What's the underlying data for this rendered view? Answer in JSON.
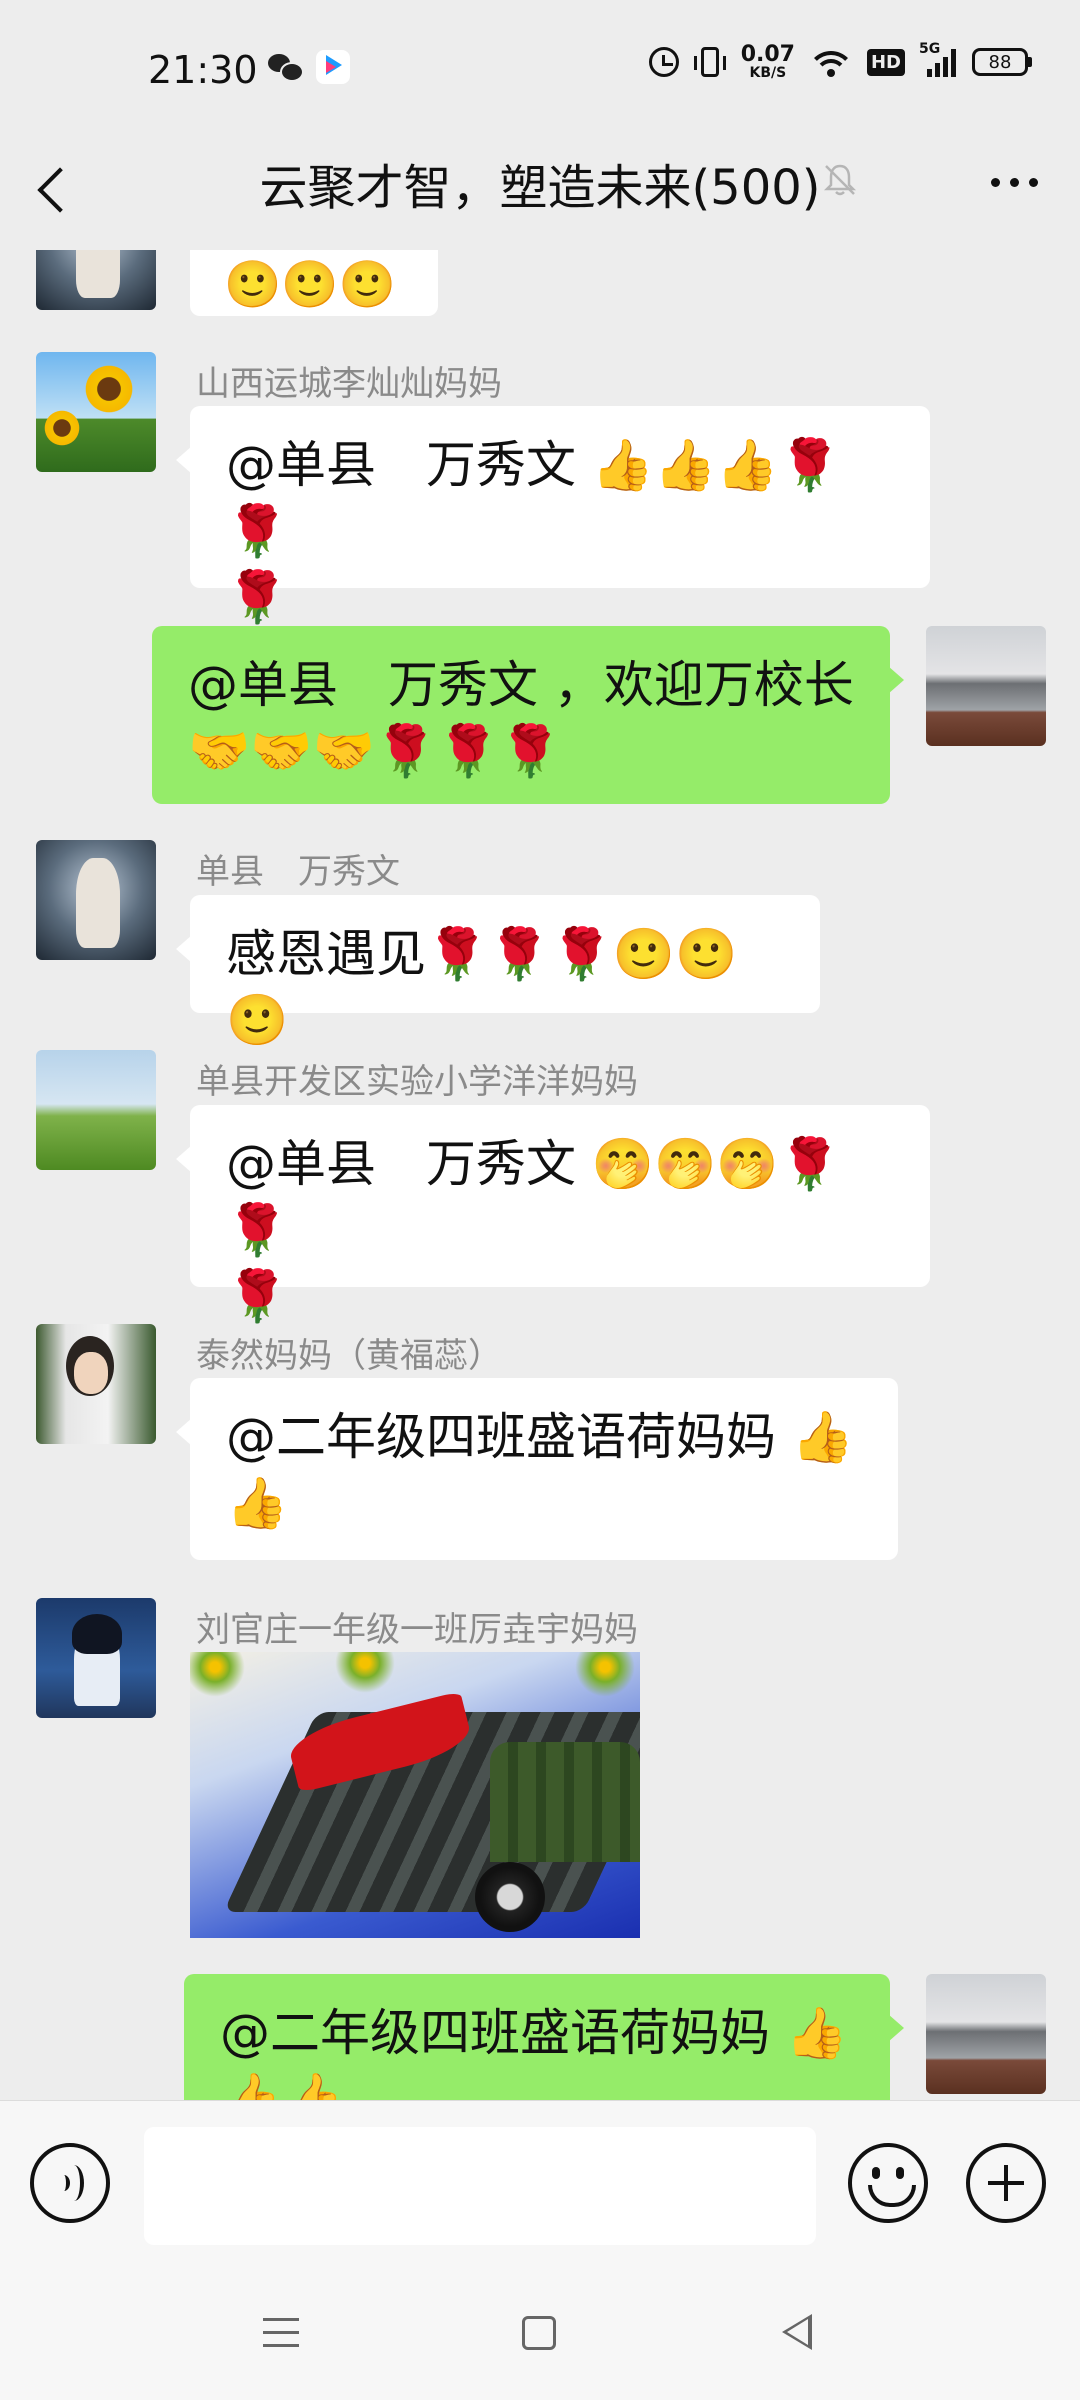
{
  "status_bar": {
    "time": "21:30",
    "net_speed": "0.07",
    "net_unit": "KB/S",
    "hd_label": "HD",
    "signal_label": "5G",
    "battery": "88",
    "icons": [
      "wechat-icon",
      "youku-icon",
      "alarm-icon",
      "vibrate-icon",
      "wifi-icon",
      "hd-icon",
      "signal-icon",
      "battery-icon"
    ]
  },
  "header": {
    "title": "云聚才智，塑造未来(500)",
    "icons": [
      "back-icon",
      "mute-bell-icon",
      "more-icon"
    ]
  },
  "messages": [
    {
      "id": 0,
      "side": "left",
      "partial": true,
      "text": "🙂🙂🙂"
    },
    {
      "id": 1,
      "side": "left",
      "sender": "山西运城李灿灿妈妈",
      "line1": "@单县　万秀文 👍👍👍🌹🌹",
      "line2": "🌹"
    },
    {
      "id": 2,
      "side": "right",
      "line1": "@单县　万秀文 ，欢迎万校长",
      "line2": "🤝🤝🤝🌹🌹🌹"
    },
    {
      "id": 3,
      "side": "left",
      "sender": "单县　万秀文",
      "line1": "感恩遇见🌹🌹🌹🙂🙂🙂"
    },
    {
      "id": 4,
      "side": "left",
      "sender": "单县开发区实验小学洋洋妈妈",
      "line1": "@单县　万秀文 🤭🤭🤭🌹🌹",
      "line2": "🌹"
    },
    {
      "id": 5,
      "side": "left",
      "sender": "泰然妈妈（黄福蕊）",
      "line1": "@二年级四班盛语荷妈妈 👍",
      "line2": "👍"
    },
    {
      "id": 6,
      "side": "left",
      "sender": "刘官庄一年级一班厉垚宇妈妈",
      "image": "military-parade-image"
    },
    {
      "id": 7,
      "side": "right",
      "line1": "@二年级四班盛语荷妈妈 👍",
      "line2": "👍👍"
    }
  ],
  "input": {
    "value": "",
    "icons": [
      "voice-icon",
      "emoji-icon",
      "plus-icon"
    ]
  },
  "nav": {
    "icons": [
      "menu-icon",
      "home-icon",
      "back-triangle-icon"
    ]
  }
}
